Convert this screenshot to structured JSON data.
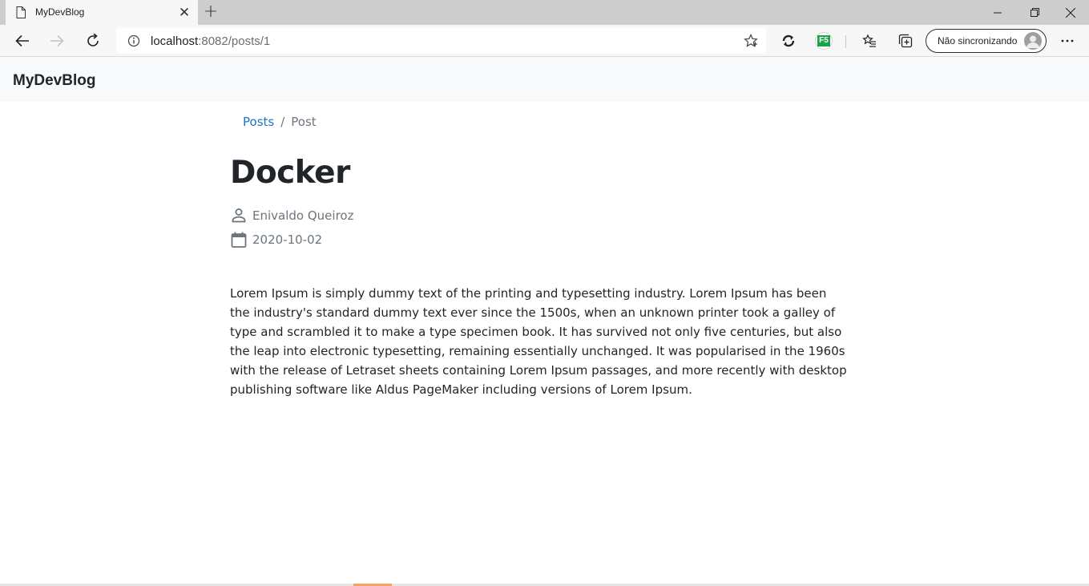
{
  "browser": {
    "tab_title": "MyDevBlog",
    "url_host": "localhost",
    "url_rest": ":8082/posts/1",
    "sync_label": "Não sincronizando",
    "extension_label": "F5"
  },
  "navbar": {
    "brand": "MyDevBlog"
  },
  "breadcrumb": {
    "link": "Posts",
    "separator": "/",
    "current": "Post"
  },
  "post": {
    "title": "Docker",
    "author": "Enivaldo Queiroz",
    "date": "2020-10-02",
    "body": "Lorem Ipsum is simply dummy text of the printing and typesetting industry. Lorem Ipsum has been the industry's standard dummy text ever since the 1500s, when an unknown printer took a galley of type and scrambled it to make a type specimen book. It has survived not only five centuries, but also the leap into electronic typesetting, remaining essentially unchanged. It was popularised in the 1960s with the release of Letraset sheets containing Lorem Ipsum passages, and more recently with desktop publishing software like Aldus PageMaker including versions of Lorem Ipsum."
  },
  "icons": {
    "author": "person-icon",
    "date": "calendar-icon"
  },
  "colors": {
    "link": "#1a73c8",
    "muted": "#6c757d",
    "navbar_bg": "#f8f9fa",
    "extension_green": "#1aa34a"
  }
}
